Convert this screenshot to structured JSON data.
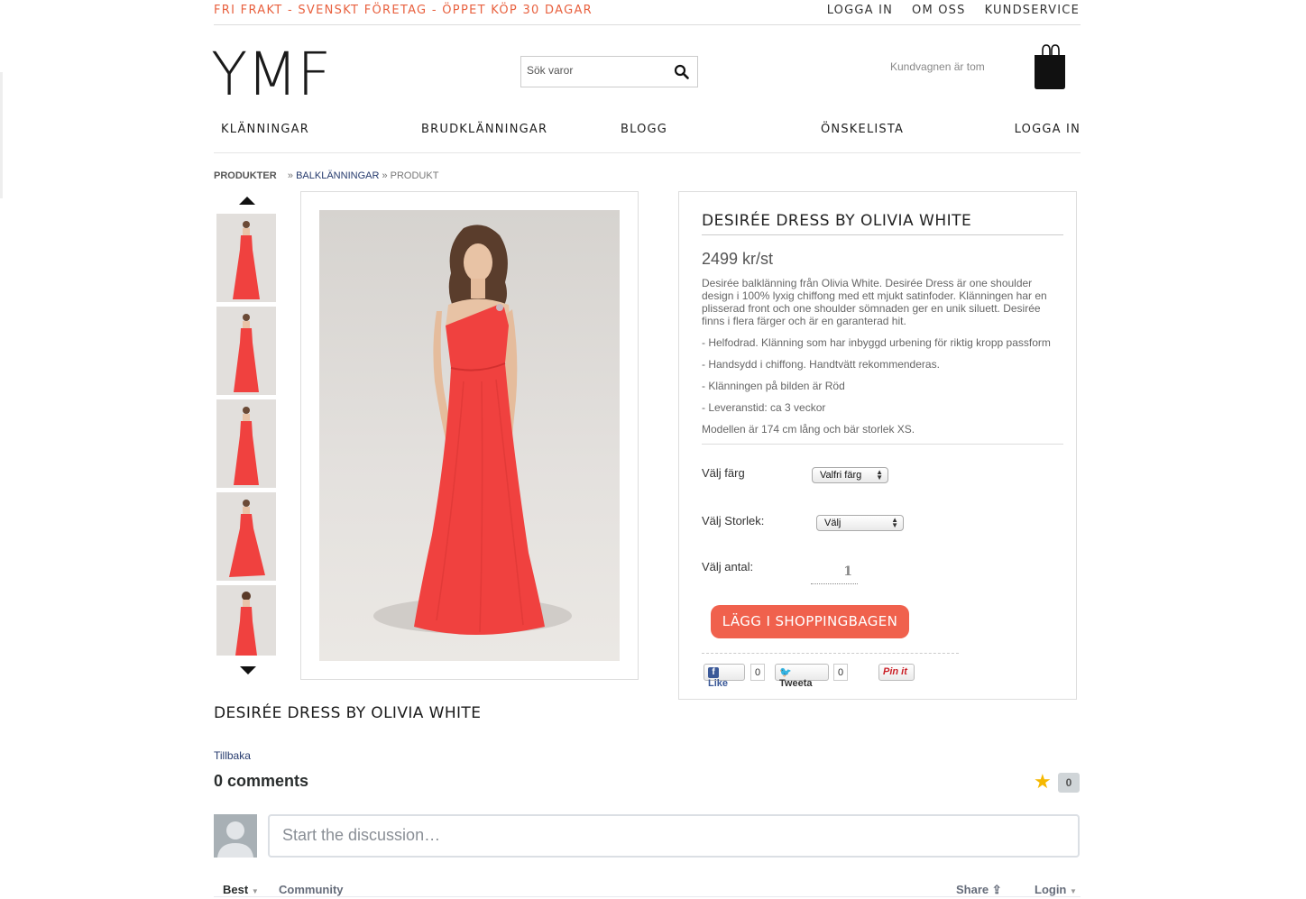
{
  "header": {
    "promo": "FRI FRAKT - SVENSKT FÖRETAG - ÖPPET KÖP 30 DAGAR",
    "top_links": [
      "LOGGA IN",
      "OM OSS",
      "KUNDSERVICE"
    ],
    "logo": "YMF",
    "search_placeholder": "Sök varor",
    "cart_text": "Kundvagnen är tom"
  },
  "nav": [
    "KLÄNNINGAR",
    "BRUDKLÄNNINGAR",
    "BLOGG",
    "ÖNSKELISTA",
    "LOGGA IN"
  ],
  "breadcrumb": {
    "root": "PRODUKTER",
    "sep1": "»",
    "category": "BALKLÄNNINGAR",
    "sep2": "» PRODUKT"
  },
  "product": {
    "title": "DESIRÉE DRESS BY OLIVIA WHITE",
    "price": "2499 kr/st",
    "description": "Desirée balklänning från Olivia White. Desirée Dress är one shoulder design i 100% lyxig chiffong med ett mjukt satinfoder. Klänningen har en plisserad front och one shoulder sömnaden ger en unik siluett. Desirée finns i flera färger och är en garanterad hit.",
    "bullets": [
      "- Helfodrad. Klänning som har inbyggd urbening för riktig kropp passform",
      "- Handsydd i chiffong. Handtvätt rekommenderas.",
      "- Klänningen på bilden är Röd",
      "- Leveranstid: ca 3 veckor",
      "Modellen är 174 cm lång och bär storlek XS."
    ],
    "color_label": "Välj färg",
    "color_value": "Valfri färg",
    "size_label": "Välj Storlek:",
    "size_value": "Välj",
    "qty_label": "Välj antal:",
    "qty_value": "1",
    "add_button": "LÄGG I SHOPPINGBAGEN",
    "social": {
      "like": "Like",
      "like_count": "0",
      "tweet": "Tweeta",
      "tweet_count": "0",
      "pin": "Pin it"
    },
    "dress_color": "#f0413f"
  },
  "below": {
    "title": "DESIRÉE DRESS BY OLIVIA WHITE",
    "back": "Tillbaka",
    "comments": "0 comments",
    "star_count": "0",
    "discuss_placeholder": "Start the discussion…",
    "tabs": {
      "best": "Best",
      "community": "Community",
      "share": "Share",
      "login": "Login"
    }
  },
  "colors": {
    "promo": "#e8613f",
    "button": "#f0614d",
    "link": "#253a6d"
  }
}
